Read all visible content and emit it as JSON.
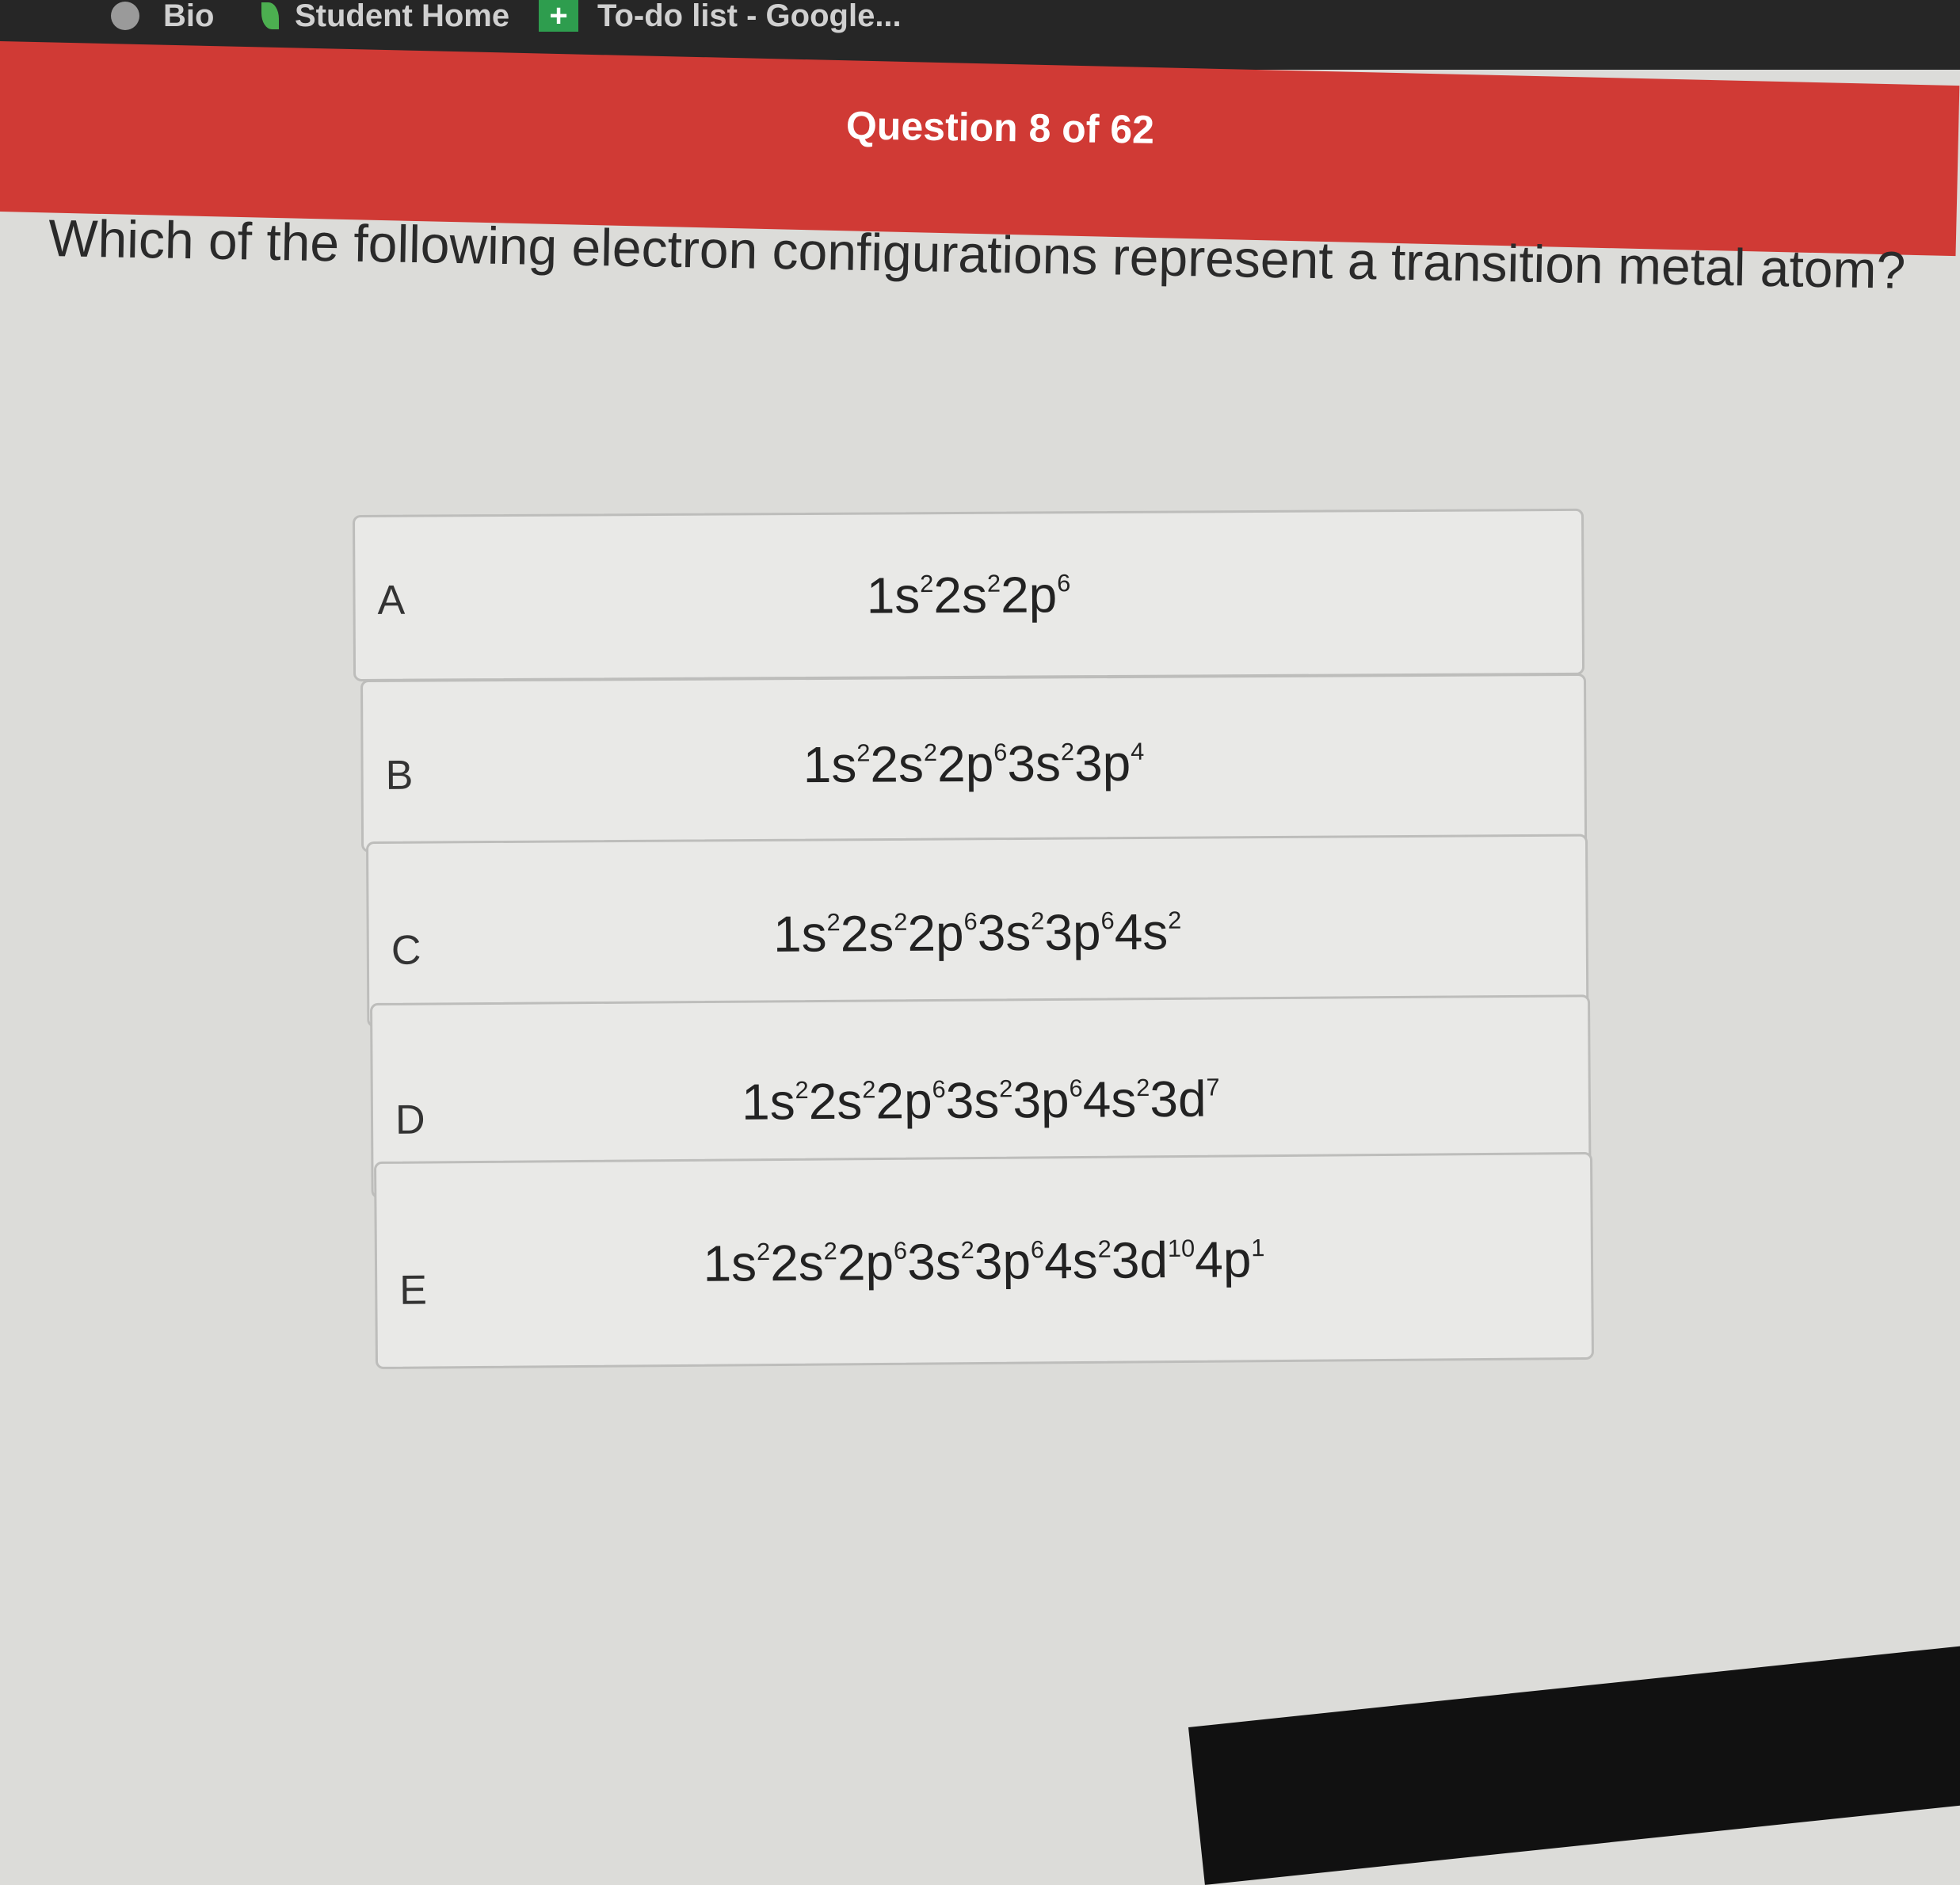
{
  "browser": {
    "bookmarks": [
      {
        "label": "Bio",
        "icon": "globe-icon"
      },
      {
        "label": "Student Home",
        "icon": "leaf-icon"
      },
      {
        "label": "To-do list - Google...",
        "icon": "plus-icon"
      }
    ]
  },
  "quiz": {
    "counter": "Question 8 of 62",
    "question": "Which of the following electron configurations represent a transition metal atom?",
    "options": [
      {
        "letter": "A",
        "parts": [
          [
            "1s",
            "2"
          ],
          [
            "2s",
            "2"
          ],
          [
            "2p",
            "6"
          ]
        ]
      },
      {
        "letter": "B",
        "parts": [
          [
            "1s",
            "2"
          ],
          [
            "2s",
            "2"
          ],
          [
            "2p",
            "6"
          ],
          [
            "3s",
            "2"
          ],
          [
            "3p",
            "4"
          ]
        ]
      },
      {
        "letter": "C",
        "parts": [
          [
            "1s",
            "2"
          ],
          [
            "2s",
            "2"
          ],
          [
            "2p",
            "6"
          ],
          [
            "3s",
            "2"
          ],
          [
            "3p",
            "6"
          ],
          [
            "4s",
            "2"
          ]
        ]
      },
      {
        "letter": "D",
        "parts": [
          [
            "1s",
            "2"
          ],
          [
            "2s",
            "2"
          ],
          [
            "2p",
            "6"
          ],
          [
            "3s",
            "2"
          ],
          [
            "3p",
            "6"
          ],
          [
            "4s",
            "2"
          ],
          [
            "3d",
            "7"
          ]
        ]
      },
      {
        "letter": "E",
        "parts": [
          [
            "1s",
            "2"
          ],
          [
            "2s",
            "2"
          ],
          [
            "2p",
            "6"
          ],
          [
            "3s",
            "2"
          ],
          [
            "3p",
            "6"
          ],
          [
            "4s",
            "2"
          ],
          [
            "3d",
            "10"
          ],
          [
            "4p",
            "1"
          ]
        ]
      }
    ]
  },
  "colors": {
    "header": "#d03a35",
    "background": "#dcdcd9",
    "option_bg": "#e9e9e7"
  }
}
